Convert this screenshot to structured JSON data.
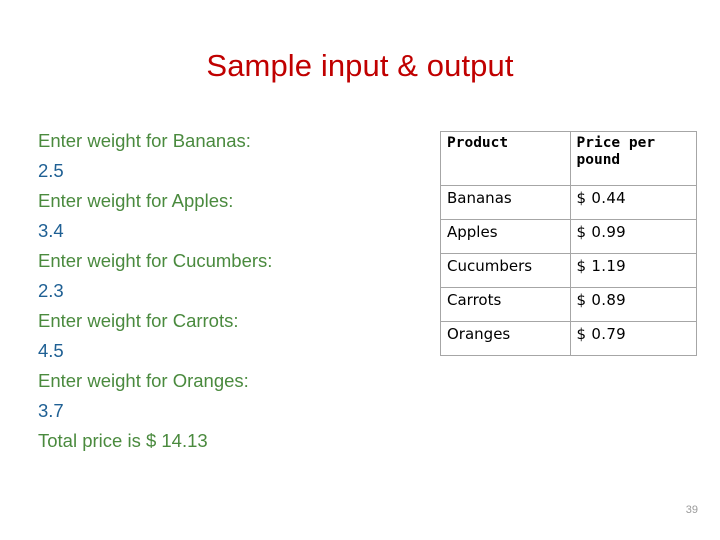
{
  "slide": {
    "title": "Sample input & output",
    "title_color": "#c00000",
    "page_number": "39",
    "background": "#ffffff"
  },
  "console": {
    "prompt_color": "#4a8a3e",
    "value_color": "#1f6094",
    "lines": [
      {
        "kind": "prompt",
        "text": "Enter weight for Bananas:"
      },
      {
        "kind": "value",
        "text": "2.5"
      },
      {
        "kind": "prompt",
        "text": "Enter weight for Apples:"
      },
      {
        "kind": "value",
        "text": "3.4"
      },
      {
        "kind": "prompt",
        "text": "Enter weight for Cucumbers:"
      },
      {
        "kind": "value",
        "text": "2.3"
      },
      {
        "kind": "prompt",
        "text": "Enter weight for Carrots:"
      },
      {
        "kind": "value",
        "text": "4.5"
      },
      {
        "kind": "prompt",
        "text": "Enter weight for Oranges:"
      },
      {
        "kind": "value",
        "text": "3.7"
      },
      {
        "kind": "total",
        "text": "Total price is $ 14.13"
      }
    ],
    "l0": "Enter weight for Bananas:",
    "l1": "2.5",
    "l2": "Enter weight for Apples:",
    "l3": "3.4",
    "l4": "Enter weight for Cucumbers:",
    "l5": "2.3",
    "l6": "Enter weight for Carrots:",
    "l7": "4.5",
    "l8": "Enter weight for Oranges:",
    "l9": "3.7",
    "l10": "Total price is $ 14.13"
  },
  "price_table": {
    "border_color": "#a6a6a6",
    "headers": [
      "Product",
      "Price per pound"
    ],
    "header_product": "Product",
    "header_price": "Price per pound",
    "rows": [
      {
        "product": "Bananas",
        "price": "$ 0.44"
      },
      {
        "product": "Apples",
        "price": "$ 0.99"
      },
      {
        "product": "Cucumbers",
        "price": "$ 1.19"
      },
      {
        "product": "Carrots",
        "price": "$ 0.89"
      },
      {
        "product": "Oranges",
        "price": "$ 0.79"
      }
    ]
  }
}
